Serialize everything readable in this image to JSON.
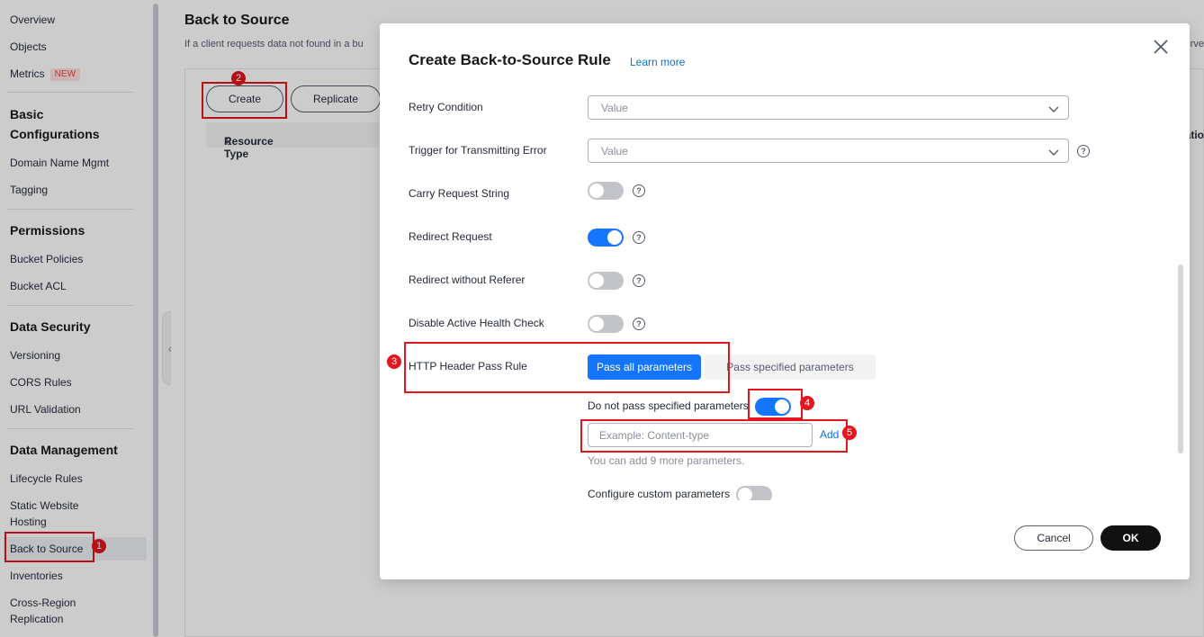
{
  "sidebar": {
    "items": [
      {
        "label": "Overview"
      },
      {
        "label": "Objects"
      },
      {
        "label": "Metrics",
        "badge": "NEW"
      }
    ],
    "groups": [
      {
        "title": "Basic Configurations",
        "items": [
          "Domain Name Mgmt",
          "Tagging"
        ]
      },
      {
        "title": "Permissions",
        "items": [
          "Bucket Policies",
          "Bucket ACL"
        ]
      },
      {
        "title": "Data Security",
        "items": [
          "Versioning",
          "CORS Rules",
          "URL Validation"
        ]
      },
      {
        "title": "Data Management",
        "items": [
          "Lifecycle Rules",
          "Static Website Hosting",
          "Back to Source",
          "Inventories",
          "Cross-Region Replication"
        ]
      }
    ],
    "active": "Back to Source"
  },
  "page": {
    "title": "Back to Source",
    "description": "If a client requests data not found in a bu",
    "description_tail": "rve",
    "create_label": "Create",
    "replicate_label": "Replicate",
    "column_resource_type": "Resource Type",
    "column_right": "atio"
  },
  "dialog": {
    "title": "Create Back-to-Source Rule",
    "learn_more": "Learn more",
    "retry_condition": {
      "label": "Retry Condition",
      "value": "Value"
    },
    "trigger_error": {
      "label": "Trigger for Transmitting Error",
      "value": "Value"
    },
    "carry_request_string": {
      "label": "Carry Request String",
      "on": false
    },
    "redirect_request": {
      "label": "Redirect Request",
      "on": true
    },
    "redirect_without_referer": {
      "label": "Redirect without Referer",
      "on": false
    },
    "disable_health_check": {
      "label": "Disable Active Health Check",
      "on": false
    },
    "header_pass_rule": {
      "label": "HTTP Header Pass Rule",
      "options": [
        "Pass all parameters",
        "Pass specified parameters"
      ],
      "selected": "Pass all parameters"
    },
    "do_not_pass": {
      "label": "Do not pass specified parameters",
      "on": true
    },
    "param_input": {
      "placeholder": "Example: Content-type",
      "value": ""
    },
    "add_label": "Add",
    "hint": "You can add 9 more parameters.",
    "custom_params": {
      "label": "Configure custom parameters",
      "on": false
    },
    "cancel_label": "Cancel",
    "ok_label": "OK"
  },
  "annotations": [
    "1",
    "2",
    "3",
    "4",
    "5"
  ],
  "colors": {
    "accent": "#1476ff",
    "highlight": "#e4151d",
    "link": "#0d6fd6"
  }
}
